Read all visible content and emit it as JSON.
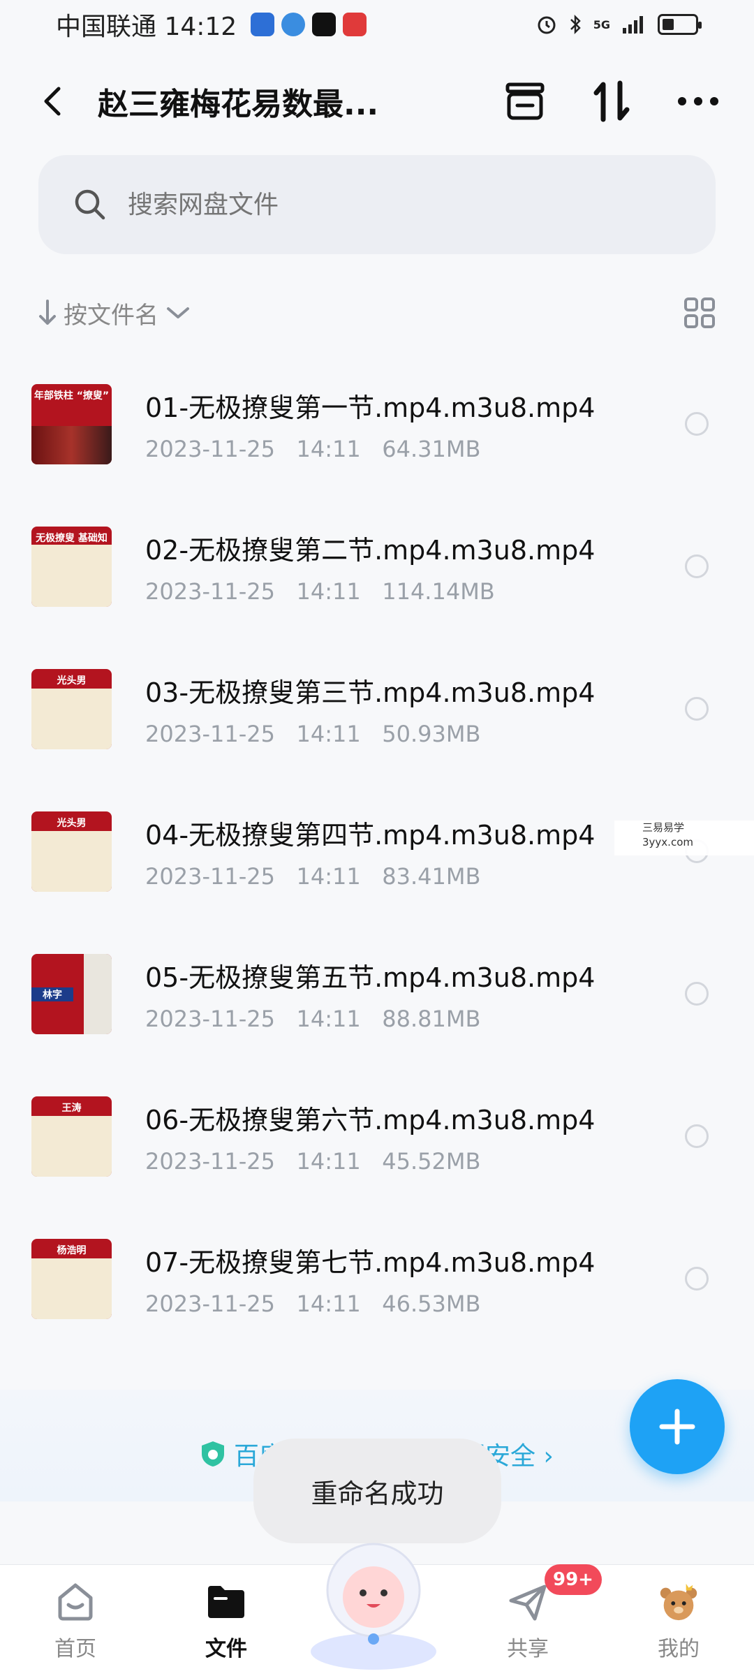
{
  "status_bar": {
    "carrier_time": "中国联通 14:12",
    "network": "5G"
  },
  "header": {
    "title": "赵三雍梅花易数最...",
    "icons": [
      "back-icon",
      "archive-icon",
      "sort-swap-icon",
      "more-icon"
    ]
  },
  "search": {
    "placeholder": "搜索网盘文件"
  },
  "sort": {
    "label": "按文件名"
  },
  "files": [
    {
      "name": "01-无极撩叟第一节.mp4.m3u8.mp4",
      "date": "2023-11-25",
      "time": "14:11",
      "size": "64.31MB",
      "thumb_label": "年部铁柱 “撩叟”"
    },
    {
      "name": "02-无极撩叟第二节.mp4.m3u8.mp4",
      "date": "2023-11-25",
      "time": "14:11",
      "size": "114.14MB",
      "thumb_label": "无极撩叟 基础知识"
    },
    {
      "name": "03-无极撩叟第三节.mp4.m3u8.mp4",
      "date": "2023-11-25",
      "time": "14:11",
      "size": "50.93MB",
      "thumb_label": "光头男"
    },
    {
      "name": "04-无极撩叟第四节.mp4.m3u8.mp4",
      "date": "2023-11-25",
      "time": "14:11",
      "size": "83.41MB",
      "thumb_label": "光头男"
    },
    {
      "name": "05-无极撩叟第五节.mp4.m3u8.mp4",
      "date": "2023-11-25",
      "time": "14:11",
      "size": "88.81MB",
      "thumb_label": "林字"
    },
    {
      "name": "06-无极撩叟第六节.mp4.m3u8.mp4",
      "date": "2023-11-25",
      "time": "14:11",
      "size": "45.52MB",
      "thumb_label": "王涛"
    },
    {
      "name": "07-无极撩叟第七节.mp4.m3u8.mp4",
      "date": "2023-11-25",
      "time": "14:11",
      "size": "46.53MB",
      "thumb_label": "杨浩明"
    }
  ],
  "watermark": {
    "line1": "三易易学",
    "line2": "3yyx.com"
  },
  "banner": {
    "security_text": "百度网盘保障你的数据安全 ›"
  },
  "toast": {
    "text": "重命名成功"
  },
  "bottom_nav": {
    "items": [
      {
        "label": "首页",
        "icon": "home-icon"
      },
      {
        "label": "文件",
        "icon": "folder-icon"
      },
      {
        "label": "共享",
        "icon": "send-icon"
      },
      {
        "label": "我的",
        "icon": "profile-bear-icon"
      }
    ],
    "badge": "99+"
  },
  "colors": {
    "accent": "#1ea2f5",
    "thumb_red": "#b3141f",
    "badge_red": "#f24a5a"
  }
}
